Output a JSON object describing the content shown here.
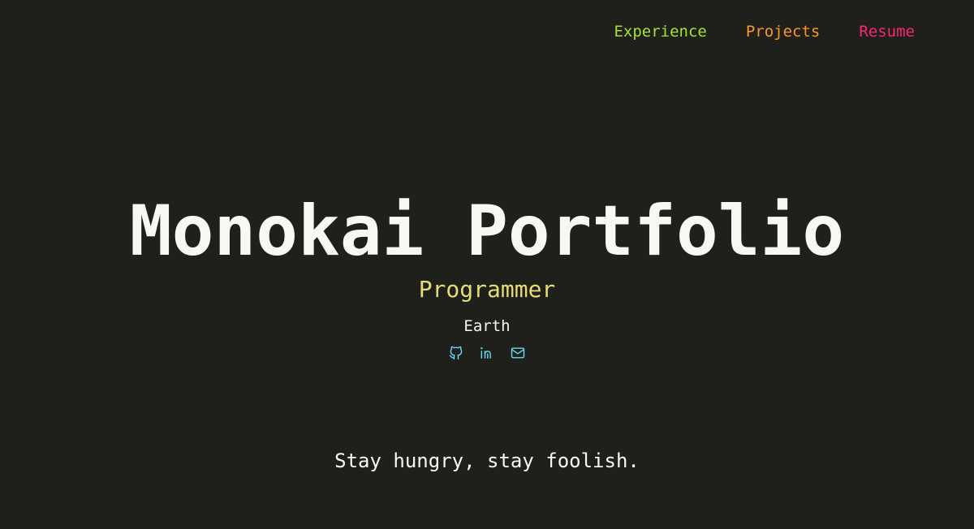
{
  "nav": {
    "items": [
      {
        "label": "Experience",
        "color": "#a6e22e"
      },
      {
        "label": "Projects",
        "color": "#fd971f"
      },
      {
        "label": "Resume",
        "color": "#f92672"
      }
    ]
  },
  "hero": {
    "title": "Monokai Portfolio",
    "role": "Programmer",
    "location": "Earth",
    "socials": [
      {
        "icon": "github-icon"
      },
      {
        "icon": "linkedin-icon"
      },
      {
        "icon": "mail-icon"
      }
    ]
  },
  "quote": "Stay hungry, stay foolish.",
  "colors": {
    "background": "#1f201c",
    "title": "#f8f8f2",
    "role": "#e6db74",
    "icons": "#66d9ef"
  }
}
